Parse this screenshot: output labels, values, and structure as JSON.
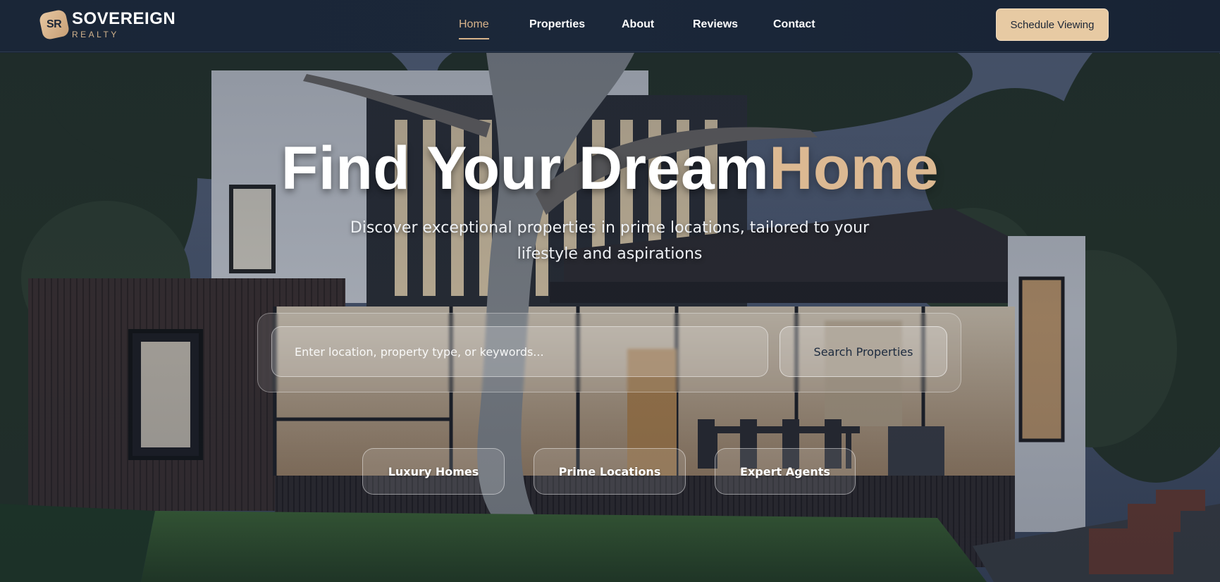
{
  "brand": {
    "monogram": "SR",
    "name": "SOVEREIGN",
    "tagline": "REALTY"
  },
  "nav": {
    "items": [
      {
        "label": "Home",
        "active": true
      },
      {
        "label": "Properties",
        "active": false
      },
      {
        "label": "About",
        "active": false
      },
      {
        "label": "Reviews",
        "active": false
      },
      {
        "label": "Contact",
        "active": false
      }
    ],
    "cta_label": "Schedule Viewing"
  },
  "hero": {
    "headline_main": "Find Your Dream",
    "headline_accent": "Home",
    "subheading": "Discover exceptional properties in prime locations, tailored to your lifestyle and aspirations",
    "search": {
      "placeholder": "Enter location, property type, or keywords...",
      "button_label": "Search Properties"
    },
    "features": [
      "Luxury Homes",
      "Prime Locations",
      "Expert Agents"
    ]
  },
  "colors": {
    "accent": "#dcb992",
    "header_bg": "#1b2739",
    "cta_bg": "#e7caa3"
  }
}
